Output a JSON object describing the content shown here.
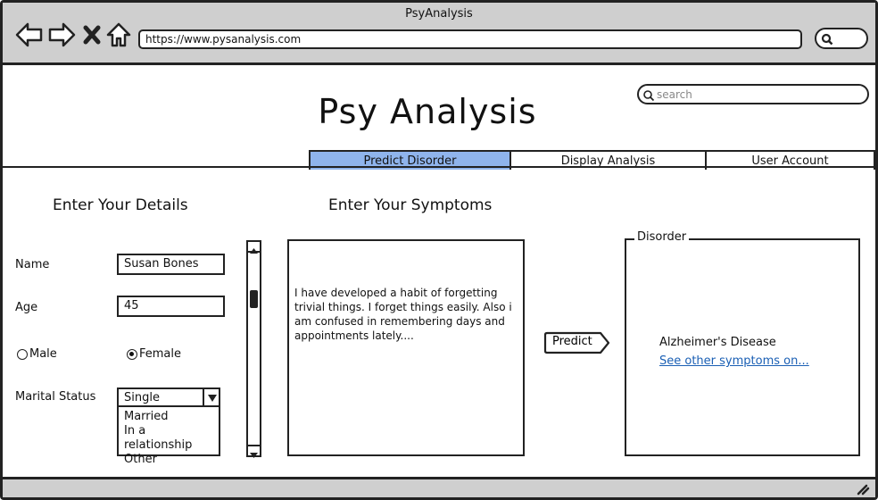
{
  "browser": {
    "window_title": "PsyAnalysis",
    "url": "https://www.pysanalysis.com"
  },
  "header": {
    "title": "Psy Analysis",
    "search_placeholder": "search"
  },
  "tabs": [
    {
      "label": "Predict Disorder",
      "active": true
    },
    {
      "label": "Display Analysis",
      "active": false
    },
    {
      "label": "User Account",
      "active": false
    }
  ],
  "details": {
    "title": "Enter Your Details",
    "name_label": "Name",
    "name_value": "Susan Bones",
    "age_label": "Age",
    "age_value": "45",
    "gender_options": [
      "Male",
      "Female"
    ],
    "gender_selected": "Female",
    "marital_label": "Marital Status",
    "marital_value": "Single",
    "marital_options": [
      "Married",
      "In a relationship",
      "Other"
    ]
  },
  "symptoms": {
    "title": "Enter Your Symptoms",
    "text": "I have developed a habit of forgetting trivial things. I forget things easily. Also i am confused in remembering days and appointments lately...."
  },
  "predict": {
    "label": "Predict"
  },
  "result": {
    "legend": "Disorder",
    "disorder": "Alzheimer's Disease",
    "link": "See other symptoms on..."
  },
  "colors": {
    "active_tab": "#8fb4ec",
    "chrome": "#cfcfcf",
    "link": "#1a5fb4"
  }
}
